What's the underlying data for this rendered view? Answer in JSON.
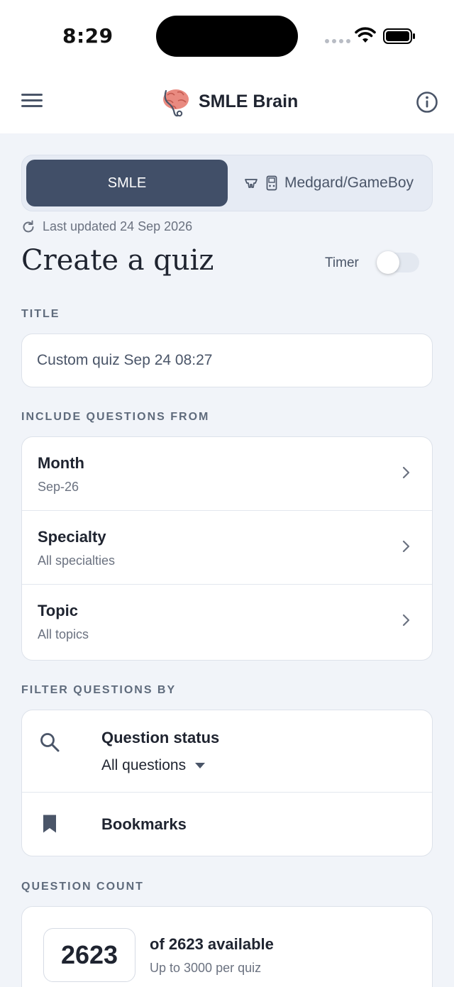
{
  "status_bar": {
    "time": "8:29"
  },
  "header": {
    "title": "SMLE Brain",
    "logo_icon": "brain-stethoscope-icon",
    "accent": "#e07a6e"
  },
  "tabs": [
    {
      "label": "SMLE",
      "active": true
    },
    {
      "label": "Medgard/GameBoy",
      "active": false
    }
  ],
  "last_updated": "Last updated 24 Sep 2026",
  "page_title": "Create a quiz",
  "timer": {
    "label": "Timer",
    "on": false
  },
  "title_section": {
    "label": "TITLE",
    "value": "Custom quiz Sep 24 08:27",
    "placeholder": "Custom quiz Sep 24 08:27"
  },
  "include_section": {
    "label": "INCLUDE QUESTIONS FROM",
    "rows": [
      {
        "title": "Month",
        "value": "Sep-26"
      },
      {
        "title": "Specialty",
        "value": "All specialties"
      },
      {
        "title": "Topic",
        "value": "All topics"
      }
    ]
  },
  "filter_section": {
    "label": "FILTER QUESTIONS BY",
    "status_title": "Question status",
    "status_value": "All questions",
    "bookmarks_label": "Bookmarks"
  },
  "count_section": {
    "label": "QUESTION COUNT",
    "value": "2623",
    "available": "of 2623 available",
    "limit": "Up to 3000 per quiz"
  },
  "colors": {
    "primary": "#414f68",
    "background": "#f1f4f9"
  }
}
